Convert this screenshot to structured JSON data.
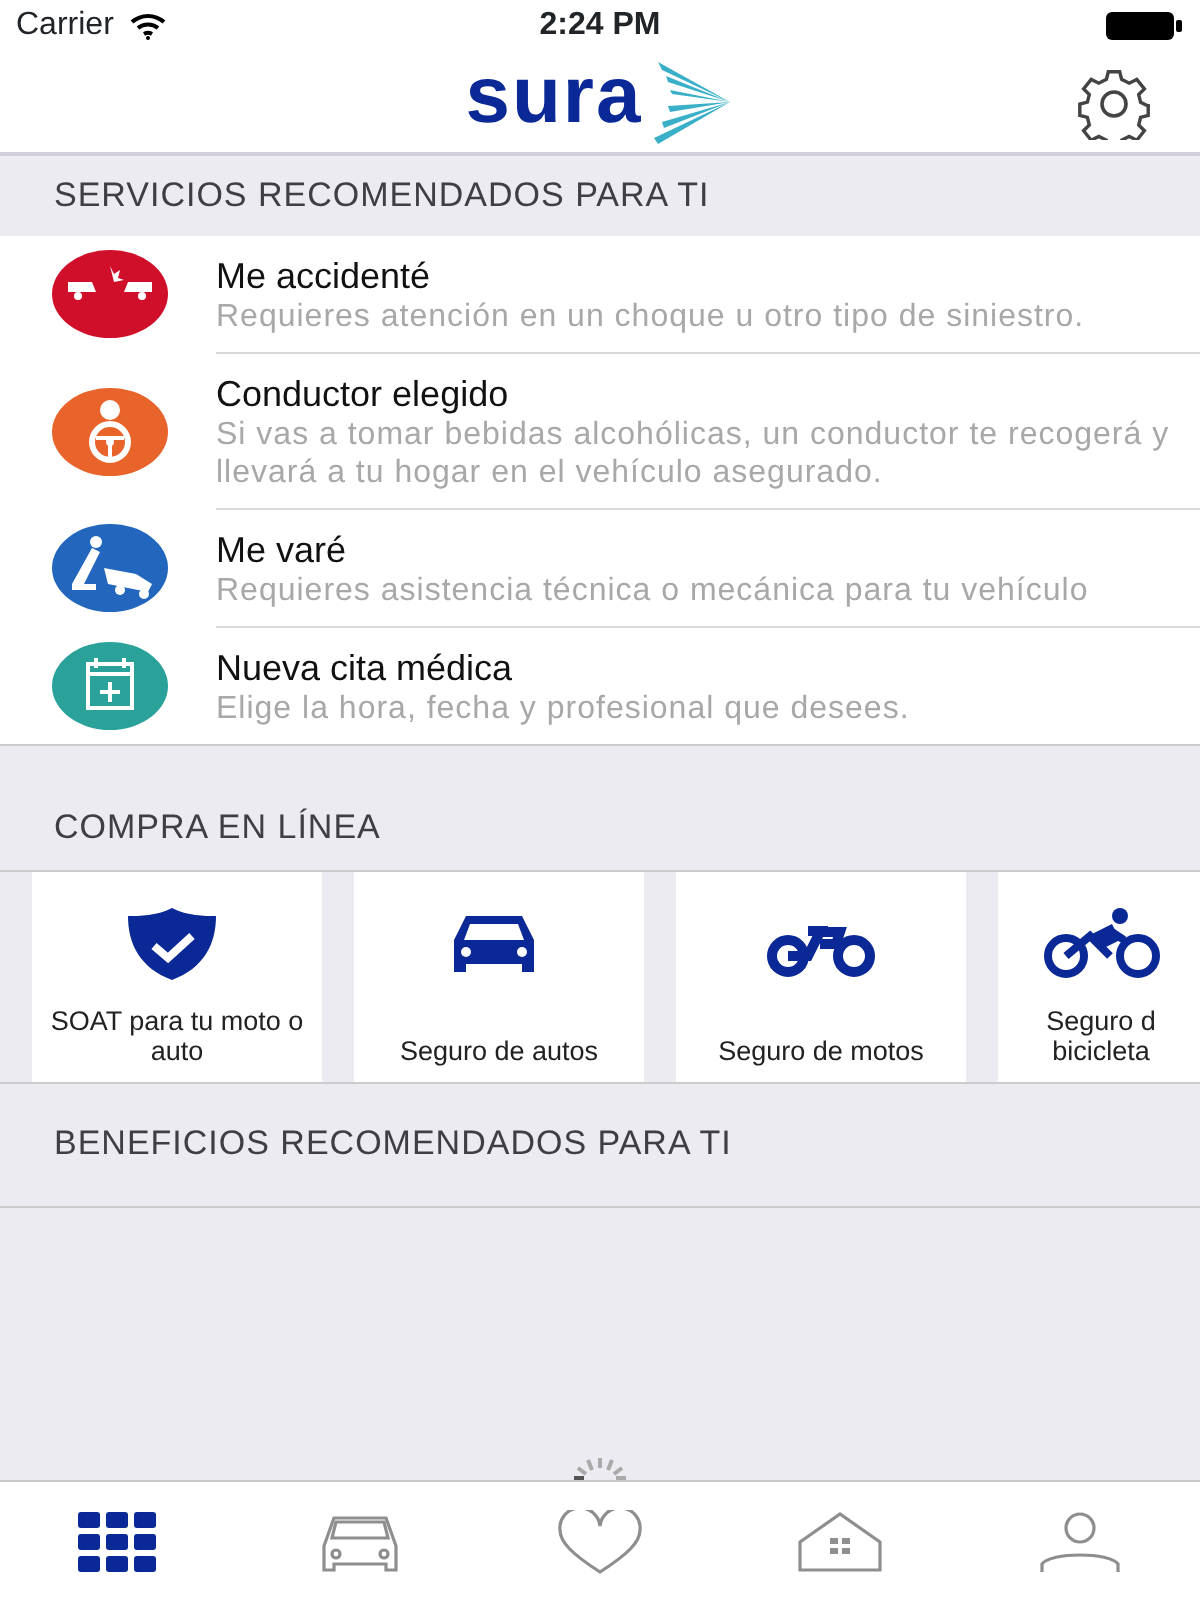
{
  "status_bar": {
    "carrier": "Carrier",
    "time": "2:24 PM"
  },
  "header": {
    "logo": "sura"
  },
  "services": {
    "title": "SERVICIOS RECOMENDADOS PARA TI",
    "items": [
      {
        "kind": "crash",
        "color": "#d0102a",
        "title": "Me accidenté",
        "description": "Requieres atención en un choque u otro tipo de siniestro."
      },
      {
        "kind": "driver",
        "color": "#e8642a",
        "title": "Conductor elegido",
        "description": "Si vas a tomar bebidas alcohólicas, un conductor te recogerá y llevará a tu hogar en el vehículo asegurado."
      },
      {
        "kind": "tow",
        "color": "#2267bd",
        "title": "Me varé",
        "description": "Requieres asistencia técnica o mecánica para tu vehículo"
      },
      {
        "kind": "medical",
        "color": "#2aa29a",
        "title": "Nueva cita médica",
        "description": "Elige la hora, fecha y profesional que desees."
      }
    ]
  },
  "purchase": {
    "title": "COMPRA EN LÍNEA",
    "items": [
      {
        "kind": "shield",
        "label": "SOAT para tu moto o auto"
      },
      {
        "kind": "car",
        "label": "Seguro de autos"
      },
      {
        "kind": "motorcycle",
        "label": "Seguro de motos"
      },
      {
        "kind": "bicycle",
        "label": "Seguro d bicicleta"
      }
    ]
  },
  "benefits": {
    "title": "BENEFICIOS RECOMENDADOS PARA TI"
  },
  "tab_bar": [
    {
      "kind": "grid",
      "selected": true
    },
    {
      "kind": "car",
      "selected": false
    },
    {
      "kind": "heart",
      "selected": false
    },
    {
      "kind": "home",
      "selected": false
    },
    {
      "kind": "person",
      "selected": false
    }
  ]
}
